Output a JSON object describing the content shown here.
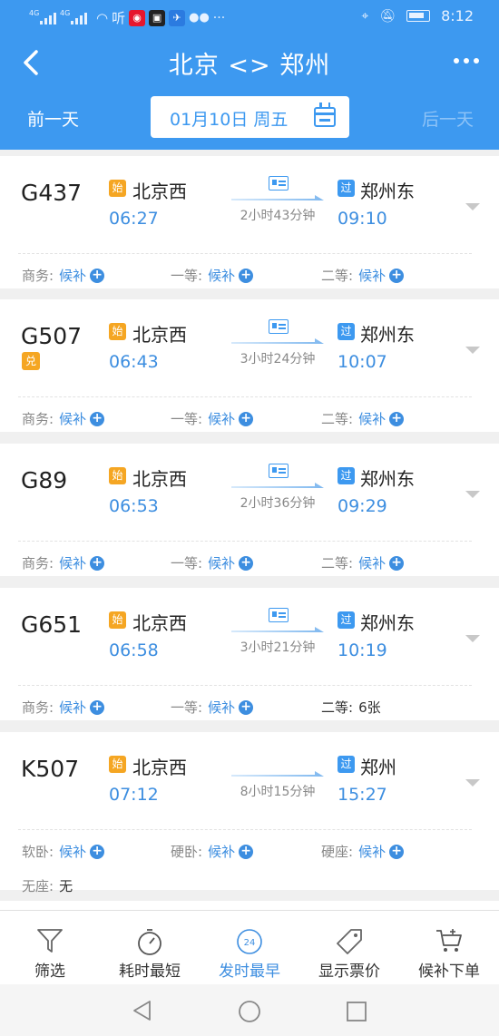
{
  "status_bar": {
    "network": "4G",
    "listen_label": "听",
    "time": "8:12"
  },
  "header": {
    "title": "北京 <> 郑州",
    "prev_day": "前一天",
    "next_day": "后一天",
    "date": "01月10日 周五"
  },
  "trains": [
    {
      "number": "G437",
      "exchange_badge": "",
      "from_tag": "始",
      "from": "北京西",
      "dep_time": "06:27",
      "duration": "2小时43分钟",
      "to_tag": "过",
      "to": "郑州东",
      "arr_time": "09:10",
      "seats": [
        {
          "label": "商务:",
          "value": "候补",
          "waitlist": true
        },
        {
          "label": "一等:",
          "value": "候补",
          "waitlist": true
        },
        {
          "label": "二等:",
          "value": "候补",
          "waitlist": true
        }
      ]
    },
    {
      "number": "G507",
      "exchange_badge": "兑",
      "from_tag": "始",
      "from": "北京西",
      "dep_time": "06:43",
      "duration": "3小时24分钟",
      "to_tag": "过",
      "to": "郑州东",
      "arr_time": "10:07",
      "seats": [
        {
          "label": "商务:",
          "value": "候补",
          "waitlist": true
        },
        {
          "label": "一等:",
          "value": "候补",
          "waitlist": true
        },
        {
          "label": "二等:",
          "value": "候补",
          "waitlist": true
        }
      ]
    },
    {
      "number": "G89",
      "exchange_badge": "",
      "from_tag": "始",
      "from": "北京西",
      "dep_time": "06:53",
      "duration": "2小时36分钟",
      "to_tag": "过",
      "to": "郑州东",
      "arr_time": "09:29",
      "seats": [
        {
          "label": "商务:",
          "value": "候补",
          "waitlist": true
        },
        {
          "label": "一等:",
          "value": "候补",
          "waitlist": true
        },
        {
          "label": "二等:",
          "value": "候补",
          "waitlist": true
        }
      ]
    },
    {
      "number": "G651",
      "exchange_badge": "",
      "from_tag": "始",
      "from": "北京西",
      "dep_time": "06:58",
      "duration": "3小时21分钟",
      "to_tag": "过",
      "to": "郑州东",
      "arr_time": "10:19",
      "seats": [
        {
          "label": "商务:",
          "value": "候补",
          "waitlist": true
        },
        {
          "label": "一等:",
          "value": "候补",
          "waitlist": true
        },
        {
          "label": "二等:",
          "value": "6张",
          "waitlist": false
        }
      ]
    },
    {
      "number": "K507",
      "exchange_badge": "",
      "from_tag": "始",
      "from": "北京西",
      "dep_time": "07:12",
      "duration": "8小时15分钟",
      "to_tag": "过",
      "to": "郑州",
      "arr_time": "15:27",
      "seats": [
        {
          "label": "软卧:",
          "value": "候补",
          "waitlist": true
        },
        {
          "label": "硬卧:",
          "value": "候补",
          "waitlist": true
        },
        {
          "label": "硬座:",
          "value": "候补",
          "waitlist": true
        },
        {
          "label": "无座:",
          "value": "无",
          "waitlist": false
        }
      ]
    }
  ],
  "bottom_bar": [
    {
      "label": "筛选",
      "icon": "filter-icon",
      "active": false
    },
    {
      "label": "耗时最短",
      "icon": "stopwatch-icon",
      "active": false
    },
    {
      "label": "发时最早",
      "icon": "clock-24-icon",
      "active": true,
      "icon_text": "24"
    },
    {
      "label": "显示票价",
      "icon": "price-tag-icon",
      "active": false
    },
    {
      "label": "候补下单",
      "icon": "cart-icon",
      "active": false
    }
  ],
  "colors": {
    "primary": "#3d99f0",
    "start_tag": "#f5a623",
    "time_blue": "#3d8ee0"
  }
}
